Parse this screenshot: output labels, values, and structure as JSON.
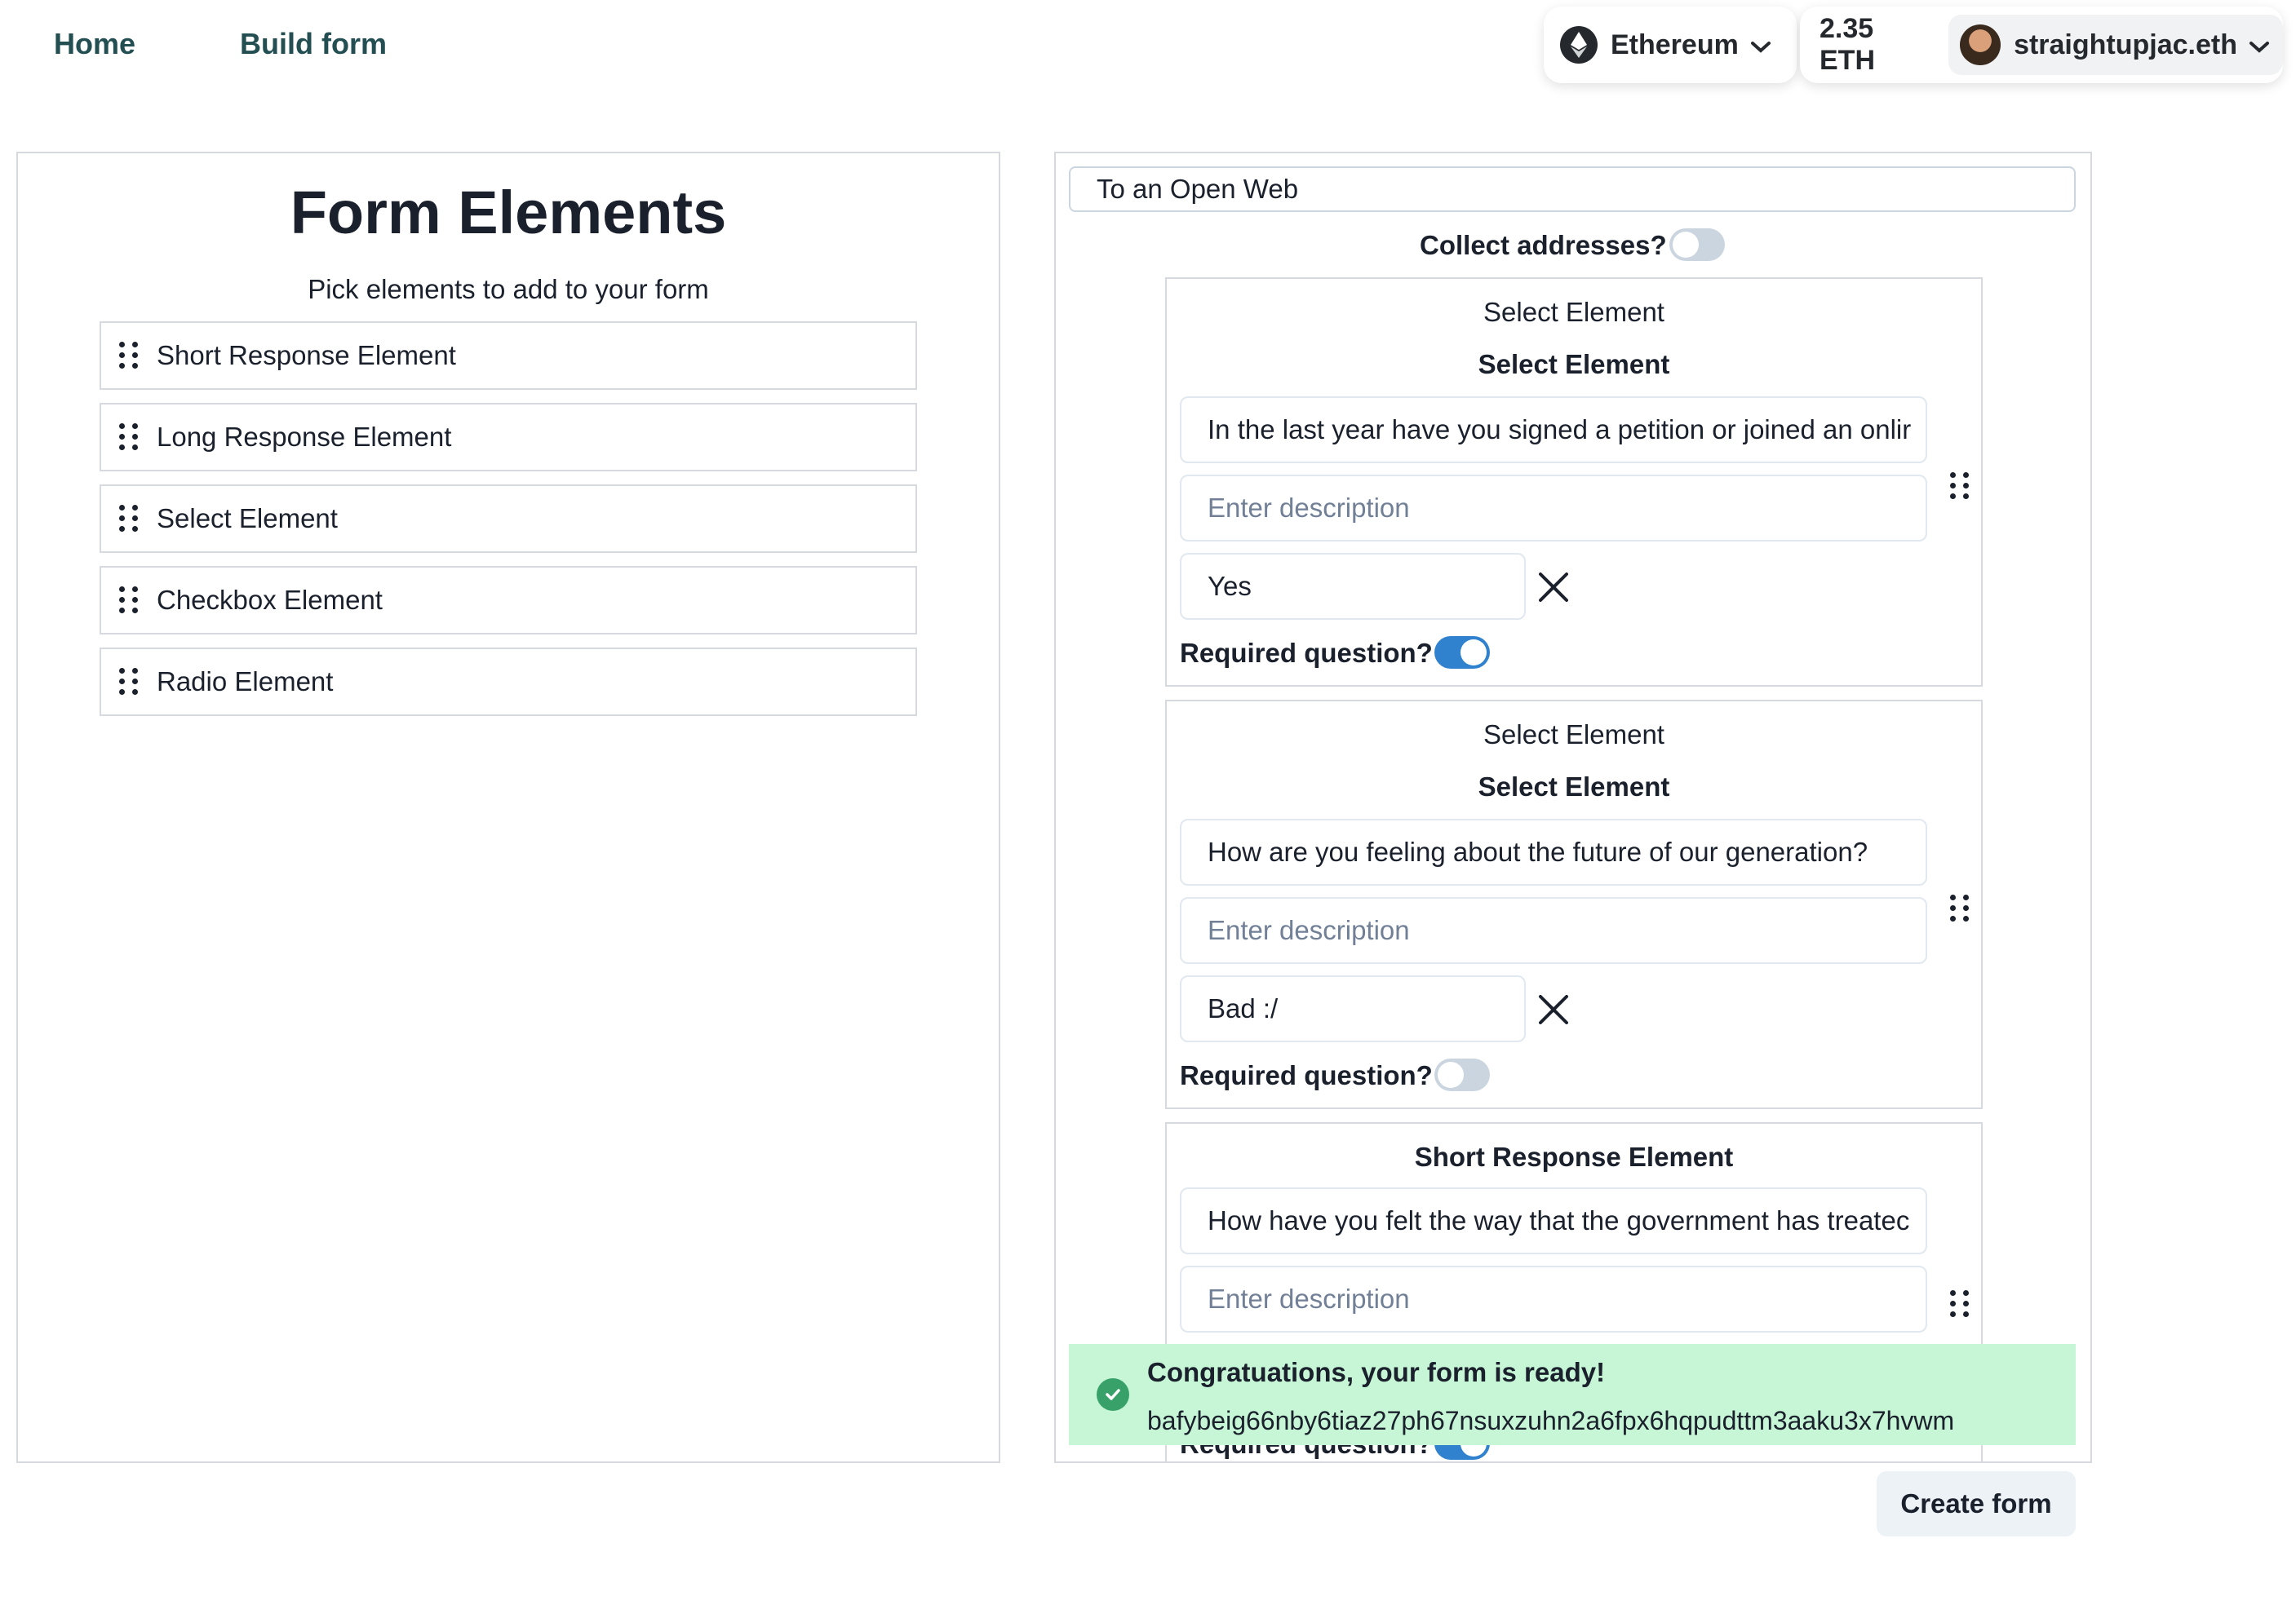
{
  "nav": {
    "home": "Home",
    "build_form": "Build form",
    "network": "Ethereum",
    "balance": "2.35 ETH",
    "account": "straightupjac.eth"
  },
  "left": {
    "title": "Form Elements",
    "subtitle": "Pick elements to add to your form",
    "items": [
      {
        "label": "Short Response Element"
      },
      {
        "label": "Long Response Element"
      },
      {
        "label": "Select Element"
      },
      {
        "label": "Checkbox Element"
      },
      {
        "label": "Radio Element"
      }
    ]
  },
  "builder": {
    "form_title": "To an Open Web",
    "collect_label": "Collect addresses?",
    "collect_on": false,
    "cards": [
      {
        "type_label": "Select Element",
        "heading": "Select Element",
        "question": "In the last year have you signed a petition or joined an onlir",
        "description_placeholder": "Enter description",
        "option": "Yes",
        "required_label": "Required question?",
        "required": true
      },
      {
        "type_label": "Select Element",
        "heading": "Select Element",
        "question": "How are you feeling about the future of our generation?",
        "description_placeholder": "Enter description",
        "option": "Bad :/",
        "required_label": "Required question?",
        "required": false
      },
      {
        "heading": "Short Response Element",
        "question": "How have you felt the way that the government has treatec",
        "description_placeholder": "Enter description",
        "required_label": "Required question?",
        "required": true
      }
    ],
    "toast": {
      "title": "Congratuations, your form is ready!",
      "cid": "bafybeig66nby6tiaz27ph67nsuxzuhn2a6fpx6hqpudttm3aaku3x7hvwm"
    },
    "create_label": "Create form"
  },
  "colors": {
    "nav_link": "#234e52",
    "toggle_on": "#3182ce",
    "toggle_off": "#cbd5e0",
    "toast_bg": "#c6f6d5",
    "success": "#38a169"
  }
}
